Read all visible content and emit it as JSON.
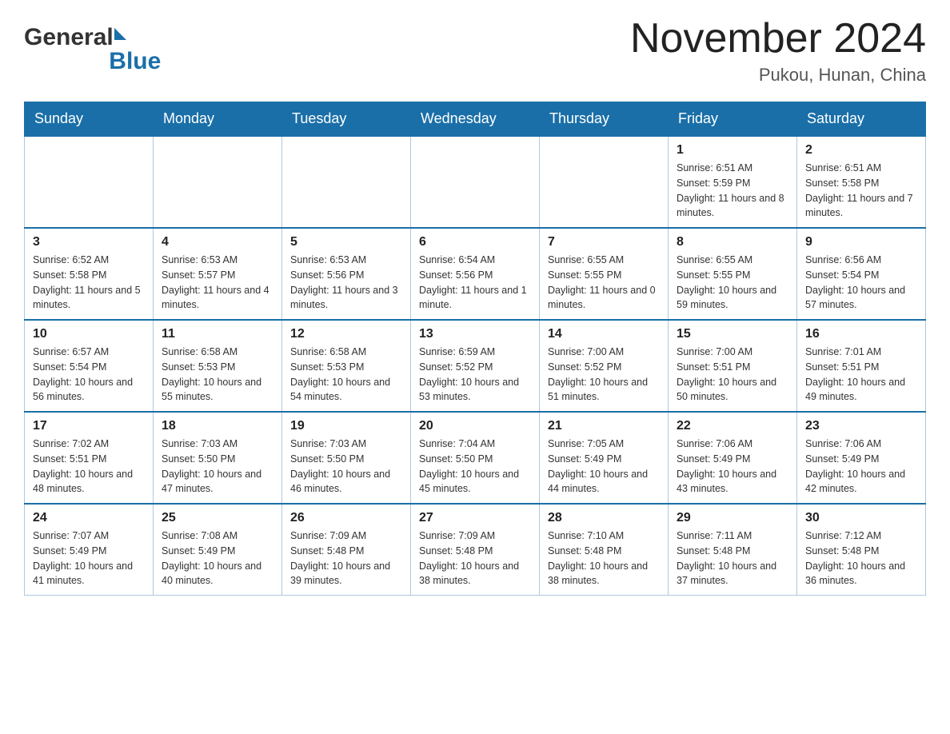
{
  "header": {
    "logo": {
      "general": "General",
      "blue": "Blue"
    },
    "title": "November 2024",
    "location": "Pukou, Hunan, China"
  },
  "calendar": {
    "days_of_week": [
      "Sunday",
      "Monday",
      "Tuesday",
      "Wednesday",
      "Thursday",
      "Friday",
      "Saturday"
    ],
    "weeks": [
      [
        {
          "day": "",
          "info": ""
        },
        {
          "day": "",
          "info": ""
        },
        {
          "day": "",
          "info": ""
        },
        {
          "day": "",
          "info": ""
        },
        {
          "day": "",
          "info": ""
        },
        {
          "day": "1",
          "info": "Sunrise: 6:51 AM\nSunset: 5:59 PM\nDaylight: 11 hours and 8 minutes."
        },
        {
          "day": "2",
          "info": "Sunrise: 6:51 AM\nSunset: 5:58 PM\nDaylight: 11 hours and 7 minutes."
        }
      ],
      [
        {
          "day": "3",
          "info": "Sunrise: 6:52 AM\nSunset: 5:58 PM\nDaylight: 11 hours and 5 minutes."
        },
        {
          "day": "4",
          "info": "Sunrise: 6:53 AM\nSunset: 5:57 PM\nDaylight: 11 hours and 4 minutes."
        },
        {
          "day": "5",
          "info": "Sunrise: 6:53 AM\nSunset: 5:56 PM\nDaylight: 11 hours and 3 minutes."
        },
        {
          "day": "6",
          "info": "Sunrise: 6:54 AM\nSunset: 5:56 PM\nDaylight: 11 hours and 1 minute."
        },
        {
          "day": "7",
          "info": "Sunrise: 6:55 AM\nSunset: 5:55 PM\nDaylight: 11 hours and 0 minutes."
        },
        {
          "day": "8",
          "info": "Sunrise: 6:55 AM\nSunset: 5:55 PM\nDaylight: 10 hours and 59 minutes."
        },
        {
          "day": "9",
          "info": "Sunrise: 6:56 AM\nSunset: 5:54 PM\nDaylight: 10 hours and 57 minutes."
        }
      ],
      [
        {
          "day": "10",
          "info": "Sunrise: 6:57 AM\nSunset: 5:54 PM\nDaylight: 10 hours and 56 minutes."
        },
        {
          "day": "11",
          "info": "Sunrise: 6:58 AM\nSunset: 5:53 PM\nDaylight: 10 hours and 55 minutes."
        },
        {
          "day": "12",
          "info": "Sunrise: 6:58 AM\nSunset: 5:53 PM\nDaylight: 10 hours and 54 minutes."
        },
        {
          "day": "13",
          "info": "Sunrise: 6:59 AM\nSunset: 5:52 PM\nDaylight: 10 hours and 53 minutes."
        },
        {
          "day": "14",
          "info": "Sunrise: 7:00 AM\nSunset: 5:52 PM\nDaylight: 10 hours and 51 minutes."
        },
        {
          "day": "15",
          "info": "Sunrise: 7:00 AM\nSunset: 5:51 PM\nDaylight: 10 hours and 50 minutes."
        },
        {
          "day": "16",
          "info": "Sunrise: 7:01 AM\nSunset: 5:51 PM\nDaylight: 10 hours and 49 minutes."
        }
      ],
      [
        {
          "day": "17",
          "info": "Sunrise: 7:02 AM\nSunset: 5:51 PM\nDaylight: 10 hours and 48 minutes."
        },
        {
          "day": "18",
          "info": "Sunrise: 7:03 AM\nSunset: 5:50 PM\nDaylight: 10 hours and 47 minutes."
        },
        {
          "day": "19",
          "info": "Sunrise: 7:03 AM\nSunset: 5:50 PM\nDaylight: 10 hours and 46 minutes."
        },
        {
          "day": "20",
          "info": "Sunrise: 7:04 AM\nSunset: 5:50 PM\nDaylight: 10 hours and 45 minutes."
        },
        {
          "day": "21",
          "info": "Sunrise: 7:05 AM\nSunset: 5:49 PM\nDaylight: 10 hours and 44 minutes."
        },
        {
          "day": "22",
          "info": "Sunrise: 7:06 AM\nSunset: 5:49 PM\nDaylight: 10 hours and 43 minutes."
        },
        {
          "day": "23",
          "info": "Sunrise: 7:06 AM\nSunset: 5:49 PM\nDaylight: 10 hours and 42 minutes."
        }
      ],
      [
        {
          "day": "24",
          "info": "Sunrise: 7:07 AM\nSunset: 5:49 PM\nDaylight: 10 hours and 41 minutes."
        },
        {
          "day": "25",
          "info": "Sunrise: 7:08 AM\nSunset: 5:49 PM\nDaylight: 10 hours and 40 minutes."
        },
        {
          "day": "26",
          "info": "Sunrise: 7:09 AM\nSunset: 5:48 PM\nDaylight: 10 hours and 39 minutes."
        },
        {
          "day": "27",
          "info": "Sunrise: 7:09 AM\nSunset: 5:48 PM\nDaylight: 10 hours and 38 minutes."
        },
        {
          "day": "28",
          "info": "Sunrise: 7:10 AM\nSunset: 5:48 PM\nDaylight: 10 hours and 38 minutes."
        },
        {
          "day": "29",
          "info": "Sunrise: 7:11 AM\nSunset: 5:48 PM\nDaylight: 10 hours and 37 minutes."
        },
        {
          "day": "30",
          "info": "Sunrise: 7:12 AM\nSunset: 5:48 PM\nDaylight: 10 hours and 36 minutes."
        }
      ]
    ]
  }
}
